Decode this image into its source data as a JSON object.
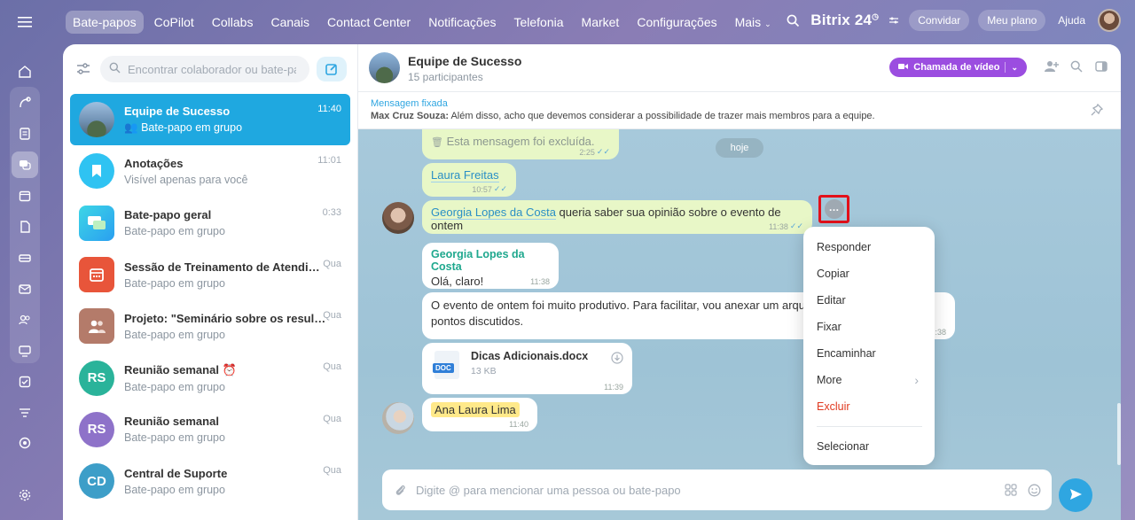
{
  "topnav": [
    "Bate-papos",
    "CoPilot",
    "Collabs",
    "Canais",
    "Contact Center",
    "Notificações",
    "Telefonia",
    "Market",
    "Configurações",
    "Mais"
  ],
  "top_right": {
    "brand": "Bitrix",
    "brand_num": "24",
    "invite": "Convidar",
    "plan": "Meu plano",
    "help": "Ajuda"
  },
  "search": {
    "placeholder": "Encontrar colaborador ou bate-papo"
  },
  "chats": [
    {
      "name": "Equipe de Sucesso",
      "sub": "Bate-papo em grupo",
      "time": "11:40"
    },
    {
      "name": "Anotações",
      "sub": "Visível apenas para você",
      "time": "11:01"
    },
    {
      "name": "Bate-papo geral",
      "sub": "Bate-papo em grupo",
      "time": "0:33"
    },
    {
      "name": "Sessão de Treinamento de Atendimento ao Cliente",
      "sub": "Bate-papo em grupo",
      "time": "Qua"
    },
    {
      "name": "Projeto: \"Seminário sobre os resultados do trimestre\"",
      "sub": "Bate-papo em grupo",
      "time": "Qua"
    },
    {
      "name": "Reunião semanal",
      "sub": "Bate-papo em grupo",
      "time": "Qua",
      "initials": "RS"
    },
    {
      "name": "Reunião semanal",
      "sub": "Bate-papo em grupo",
      "time": "Qua",
      "initials": "RS"
    },
    {
      "name": "Central de Suporte",
      "sub": "Bate-papo em grupo",
      "time": "Qua",
      "initials": "CD"
    }
  ],
  "header": {
    "title": "Equipe de Sucesso",
    "participants": "15 participantes",
    "video_call": "Chamada de vídeo"
  },
  "pinned": {
    "label": "Mensagem fixada",
    "author": "Max Cruz Souza:",
    "text": "Além disso, acho que devemos considerar a possibilidade de trazer mais membros para a equipe."
  },
  "messages": {
    "deleted": {
      "text": "Esta mensagem foi excluída.",
      "time": "2:25"
    },
    "date": "hoje",
    "m1": {
      "mention": "Laura Freitas",
      "time": "10:57"
    },
    "m2": {
      "mention": "Georgia Lopes da Costa",
      "text": " queria saber sua opinião sobre o evento de ontem",
      "time": "11:38"
    },
    "m3": {
      "author": "Georgia Lopes da Costa",
      "text": "Olá, claro!",
      "time": "11:38"
    },
    "m4": {
      "text": "O evento de ontem foi muito produtivo. Para facilitar, vou anexar um arquivo com os principais pontos discutidos.",
      "time": "11:38"
    },
    "m5": {
      "file_name": "Dicas Adicionais.docx",
      "file_size": "13 KB",
      "file_badge": "DOC",
      "time": "11:39"
    },
    "m6": {
      "mention": "Ana Laura Lima",
      "time": "11:40"
    }
  },
  "context_menu": [
    "Responder",
    "Copiar",
    "Editar",
    "Fixar",
    "Encaminhar",
    "More",
    "Excluir",
    "Selecionar"
  ],
  "composer": {
    "placeholder": "Digite @ para mencionar uma pessoa ou bate-papo"
  },
  "colors": {
    "accent": "#1fa8e0",
    "video": "#9b4de0",
    "danger": "#e0391f",
    "own_bubble": "#e8f7c7"
  }
}
